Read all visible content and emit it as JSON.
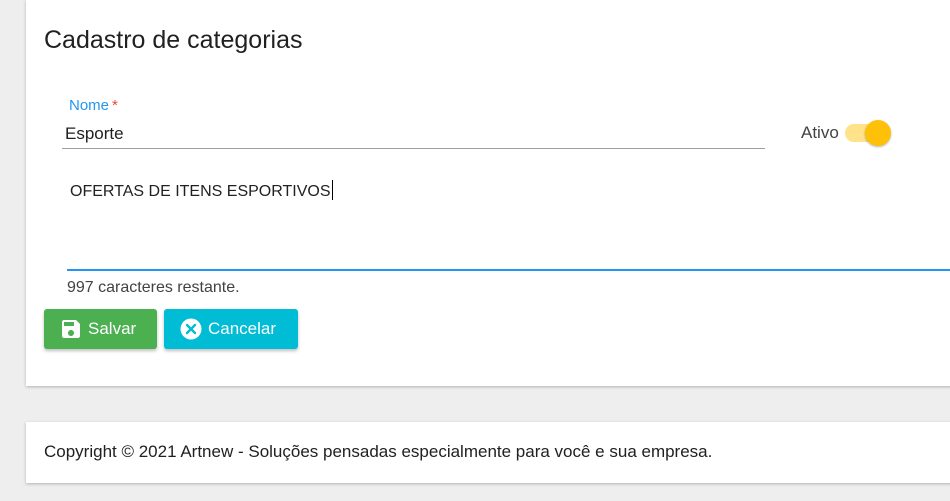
{
  "page_title": "Cadastro de categorias",
  "form": {
    "name_label": "Nome",
    "name_required_mark": "*",
    "name_value": "Esporte",
    "active_label": "Ativo",
    "active_on": true,
    "description_value": "OFERTAS DE ITENS ESPORTIVOS",
    "char_counter": "997 caracteres restante."
  },
  "buttons": {
    "save_label": "Salvar",
    "save_icon": "floppy-disk-icon",
    "cancel_label": "Cancelar",
    "cancel_icon": "close-circle-icon"
  },
  "footer": {
    "copyright": "Copyright © 2021 Artnew - Soluções pensadas especialmente para você e sua empresa."
  },
  "colors": {
    "primary": "#2196f3",
    "required": "#f44336",
    "save": "#4caf50",
    "cancel": "#00bcd4",
    "toggle_on": "#ffc107"
  }
}
